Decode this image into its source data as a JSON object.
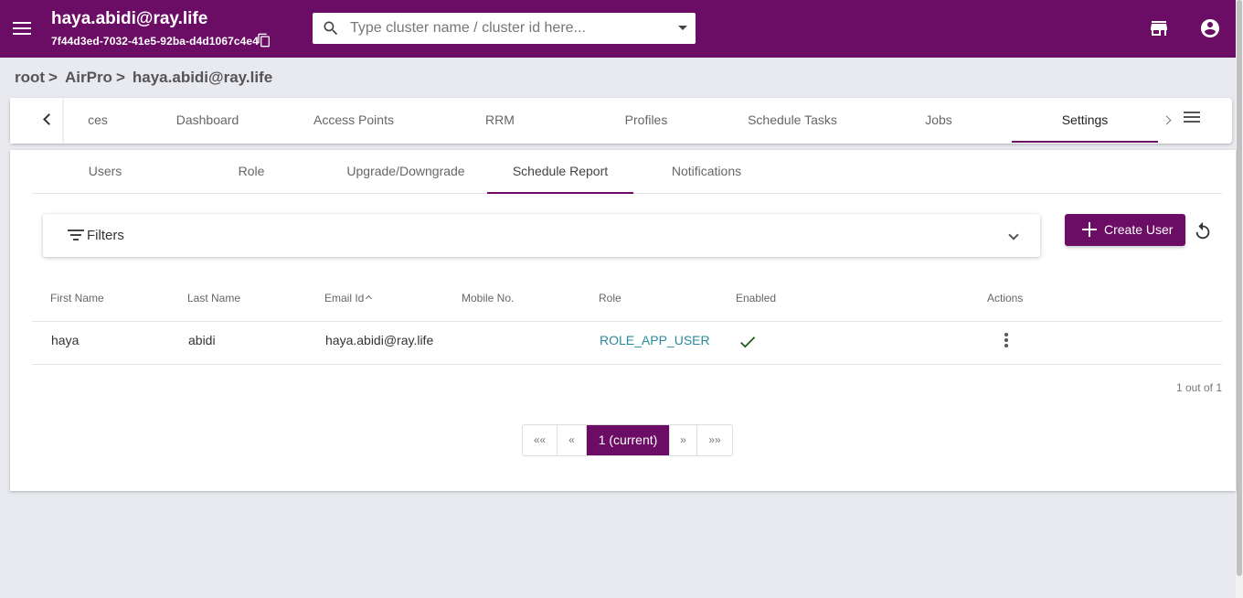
{
  "header": {
    "account_email": "haya.abidi@ray.life",
    "account_id": "7f44d3ed-7032-41e5-92ba-d4d1067c4e4",
    "search_placeholder": "Type cluster name / cluster id here...",
    "accent_color": "#6b0d64"
  },
  "breadcrumb": [
    "root",
    "AirPro",
    "haya.abidi@ray.life"
  ],
  "breadcrumb_separator": ">",
  "main_tabs": [
    {
      "label": "ces",
      "active": false
    },
    {
      "label": "Dashboard",
      "active": false
    },
    {
      "label": "Access Points",
      "active": false
    },
    {
      "label": "RRM",
      "active": false
    },
    {
      "label": "Profiles",
      "active": false
    },
    {
      "label": "Schedule Tasks",
      "active": false
    },
    {
      "label": "Jobs",
      "active": false
    },
    {
      "label": "Settings",
      "active": true
    }
  ],
  "sub_tabs": [
    {
      "label": "Users",
      "active": false
    },
    {
      "label": "Role",
      "active": false
    },
    {
      "label": "Upgrade/Downgrade",
      "active": false
    },
    {
      "label": "Schedule Report",
      "active": true
    },
    {
      "label": "Notifications",
      "active": false
    }
  ],
  "filters": {
    "label": "Filters"
  },
  "create_button": {
    "label": "Create User"
  },
  "table": {
    "columns": [
      "First Name",
      "Last Name",
      "Email Id",
      "Mobile No.",
      "Role",
      "Enabled",
      "Actions"
    ],
    "sorted_column": "Email Id",
    "rows": [
      {
        "first_name": "haya",
        "last_name": "abidi",
        "email": "haya.abidi@ray.life",
        "mobile": "",
        "role": "ROLE_APP_USER",
        "enabled": true
      }
    ]
  },
  "count_text": "1 out of 1",
  "pagination": {
    "first": "««",
    "prev": "«",
    "current": "1 (current)",
    "next": "»",
    "last": "»»"
  },
  "icons": [
    "menu-icon",
    "copy-icon",
    "search-icon",
    "chevron-down-icon",
    "store-icon",
    "account-circle-icon",
    "chevron-left-icon",
    "chevron-right-icon",
    "list-menu-icon",
    "filter-icon",
    "plus-icon",
    "refresh-icon",
    "check-icon",
    "more-vert-icon"
  ]
}
